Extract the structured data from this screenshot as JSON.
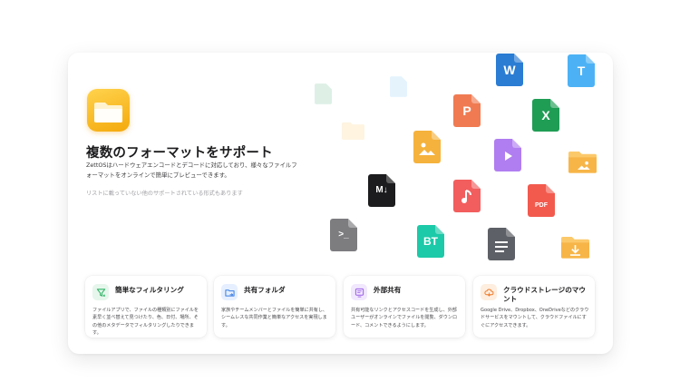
{
  "hero": {
    "title": "複数のフォーマットをサポート",
    "description": "ZettOSはハードウェアエンコードとデコードに対応しており、様々なファイルフォーマットをオンラインで簡単にプレビューできます。",
    "note": "リストに載っていない他のサポートされている形式もあります"
  },
  "file_icons": [
    {
      "name": "word-file-icon",
      "label": "W",
      "color": "#2b7cd3"
    },
    {
      "name": "text-file-icon",
      "label": "T",
      "color": "#4cb2f5"
    },
    {
      "name": "powerpoint-file-icon",
      "label": "P",
      "color": "#f07b52"
    },
    {
      "name": "excel-file-icon",
      "label": "X",
      "color": "#1f9d55"
    },
    {
      "name": "image-file-icon",
      "label": "",
      "color": "#f5b23c"
    },
    {
      "name": "video-file-icon",
      "label": "",
      "color": "#b07ef0"
    },
    {
      "name": "image-folder-icon",
      "label": "",
      "color": "#fcc96a"
    },
    {
      "name": "markdown-file-icon",
      "label": "M↓",
      "color": "#1c1c1e"
    },
    {
      "name": "audio-file-icon",
      "label": "",
      "color": "#f25e5e"
    },
    {
      "name": "pdf-file-icon",
      "label": "PDF",
      "color": "#f25a4e"
    },
    {
      "name": "terminal-file-icon",
      "label": ">_",
      "color": "#7d7d80"
    },
    {
      "name": "torrent-file-icon",
      "label": "BT",
      "color": "#1cc9a8"
    },
    {
      "name": "document-file-icon",
      "label": "",
      "color": "#5d6066"
    },
    {
      "name": "download-folder-icon",
      "label": "",
      "color": "#fcc96a"
    }
  ],
  "features": [
    {
      "title": "簡単なフィルタリング",
      "description": "ファイルアプリで、ファイルの種類別にファイルを素早く並べ替えて見つけたり、色、日付、場所、その他のメタデータでフィルタリングしたりできます。",
      "icon": "filter-icon",
      "accent": "#35b56a",
      "bg": "#e6f6ec"
    },
    {
      "title": "共有フォルダ",
      "description": "家族やチームメンバーとファイルを簡単に共有し、シームレスな共同作業と簡単なアクセスを実現します。",
      "icon": "shared-folder-icon",
      "accent": "#3b7ee0",
      "bg": "#e5efff"
    },
    {
      "title": "外部共有",
      "description": "共有可能なリンクとアクセスコードを生成し、外部ユーザーがオンラインでファイルを閲覧、ダウンロード、コメントできるようにします。",
      "icon": "external-share-icon",
      "accent": "#9b5de5",
      "bg": "#f1e8fd"
    },
    {
      "title": "クラウドストレージのマウント",
      "description": "Google Drive、Dropbox、OneDriveなどのクラウドサービスをマウントして、クラウドファイルにすぐにアクセスできます。",
      "icon": "cloud-mount-icon",
      "accent": "#f07a2c",
      "bg": "#fdeedf"
    }
  ]
}
